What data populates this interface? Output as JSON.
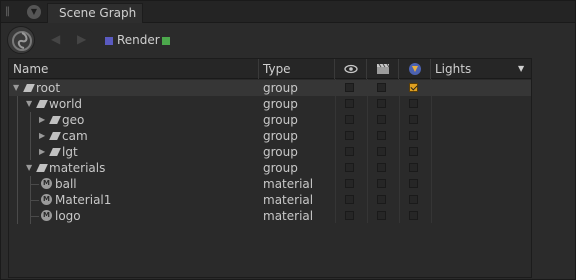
{
  "tab": {
    "label": "Scene Graph"
  },
  "toolbar": {
    "render_label": "Render"
  },
  "columns": {
    "name": "Name",
    "type": "Type",
    "lights": "Lights"
  },
  "rows": [
    {
      "name": "root",
      "type": "group",
      "kind": "group",
      "depth": 0,
      "expanded": true,
      "visible": false,
      "render": false,
      "light": true
    },
    {
      "name": "world",
      "type": "group",
      "kind": "group",
      "depth": 1,
      "expanded": true,
      "visible": false,
      "render": false,
      "light": false
    },
    {
      "name": "geo",
      "type": "group",
      "kind": "group",
      "depth": 2,
      "expanded": false,
      "visible": false,
      "render": false,
      "light": false
    },
    {
      "name": "cam",
      "type": "group",
      "kind": "group",
      "depth": 2,
      "expanded": false,
      "visible": false,
      "render": false,
      "light": false
    },
    {
      "name": "lgt",
      "type": "group",
      "kind": "group",
      "depth": 2,
      "expanded": false,
      "visible": false,
      "render": false,
      "light": false
    },
    {
      "name": "materials",
      "type": "group",
      "kind": "group",
      "depth": 1,
      "expanded": true,
      "visible": false,
      "render": false,
      "light": false
    },
    {
      "name": "ball",
      "type": "material",
      "kind": "material",
      "depth": 2,
      "expanded": null,
      "visible": false,
      "render": false,
      "light": false
    },
    {
      "name": "Material1",
      "type": "material",
      "kind": "material",
      "depth": 2,
      "expanded": null,
      "visible": false,
      "render": false,
      "light": false
    },
    {
      "name": "logo",
      "type": "material",
      "kind": "material",
      "depth": 2,
      "expanded": null,
      "visible": false,
      "render": false,
      "light": false
    }
  ],
  "colors": {
    "render_swatch": "#5a5ac0",
    "render_swatch_2": "#4ca84c",
    "checked": "#e0a020"
  },
  "icons": {
    "visibility_header": "eye-icon",
    "render_header": "clapperboard-icon",
    "lights_header": "light-link-icon",
    "group_node": "group-node-icon",
    "material_node": "material-node-icon"
  }
}
